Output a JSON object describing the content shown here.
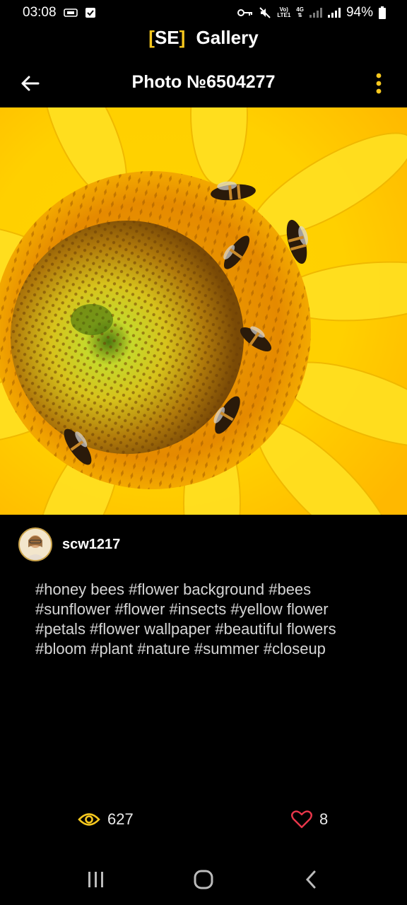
{
  "status_bar": {
    "time": "03:08",
    "network_top": "Vo)",
    "network_bottom": "LTE1",
    "network_type": "4G",
    "battery": "94%"
  },
  "app": {
    "brand_bracket_open": "[",
    "brand_short": "SE",
    "brand_bracket_close": "]",
    "brand_name": "Gallery",
    "accent_color": "#f7c81e"
  },
  "top_bar": {
    "title": "Photo №6504277"
  },
  "author": {
    "username": "scw1217"
  },
  "tags_text": "#honey bees #flower background #bees #sunflower #flower #insects #yellow flower #petals #flower wallpaper #beautiful flowers #bloom #plant #nature #summer #closeup",
  "stats": {
    "views": "627",
    "likes": "8",
    "like_color": "#e8364a",
    "view_color": "#f7c81e"
  },
  "icons": {
    "back": "arrow-left-icon",
    "more": "more-vertical-icon",
    "views": "eye-icon",
    "likes": "heart-icon",
    "nav_recents": "recents-icon",
    "nav_home": "home-icon",
    "nav_back": "chevron-left-icon"
  }
}
